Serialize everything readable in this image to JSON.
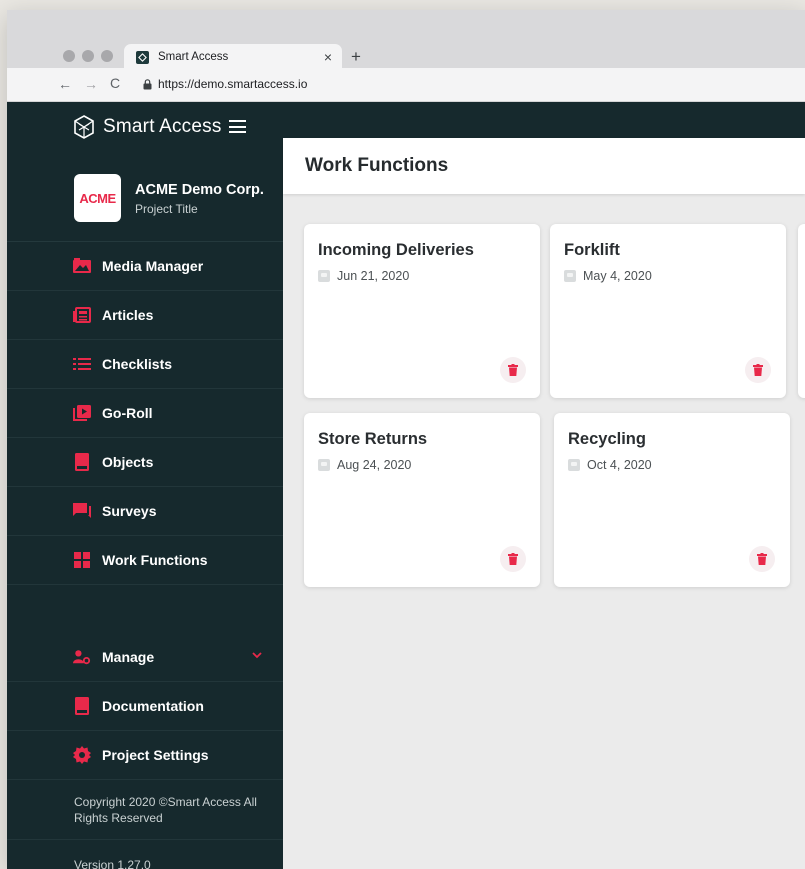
{
  "browser": {
    "tab_title": "Smart Access",
    "tab_close": "×",
    "new_tab": "+",
    "url": "https://demo.smartaccess.io",
    "back": "←",
    "forward": "→",
    "reload": "C"
  },
  "brand": {
    "name": "Smart Access"
  },
  "org": {
    "logo_text": "ACME",
    "name": "ACME Demo Corp.",
    "subtitle": "Project Title"
  },
  "sidebar": {
    "items": [
      {
        "label": "Media Manager",
        "icon": "image-icon"
      },
      {
        "label": "Articles",
        "icon": "newspaper-icon"
      },
      {
        "label": "Checklists",
        "icon": "list-icon"
      },
      {
        "label": "Go-Roll",
        "icon": "play-icon"
      },
      {
        "label": "Objects",
        "icon": "bookmark-icon"
      },
      {
        "label": "Surveys",
        "icon": "chat-icon"
      },
      {
        "label": "Work Functions",
        "icon": "grid-icon"
      }
    ],
    "bottom_items": [
      {
        "label": "Manage",
        "icon": "user-cog-icon"
      },
      {
        "label": "Documentation",
        "icon": "book-icon"
      },
      {
        "label": "Project Settings",
        "icon": "gear-icon"
      }
    ],
    "copyright": "Copyright 2020 ©Smart Access All Rights Reserved",
    "version": "Version 1.27.0"
  },
  "page": {
    "title": "Work Functions"
  },
  "cards": [
    {
      "title": "Incoming Deliveries",
      "date": "Jun 21, 2020"
    },
    {
      "title": "Forklift",
      "date": "May 4, 2020"
    },
    {
      "title": "Store Returns",
      "date": "Aug 24, 2020"
    },
    {
      "title": "Recycling",
      "date": "Oct 4, 2020"
    }
  ],
  "colors": {
    "sidebar": "#16292d",
    "accent": "#e8294a",
    "background": "#ebebeb"
  }
}
